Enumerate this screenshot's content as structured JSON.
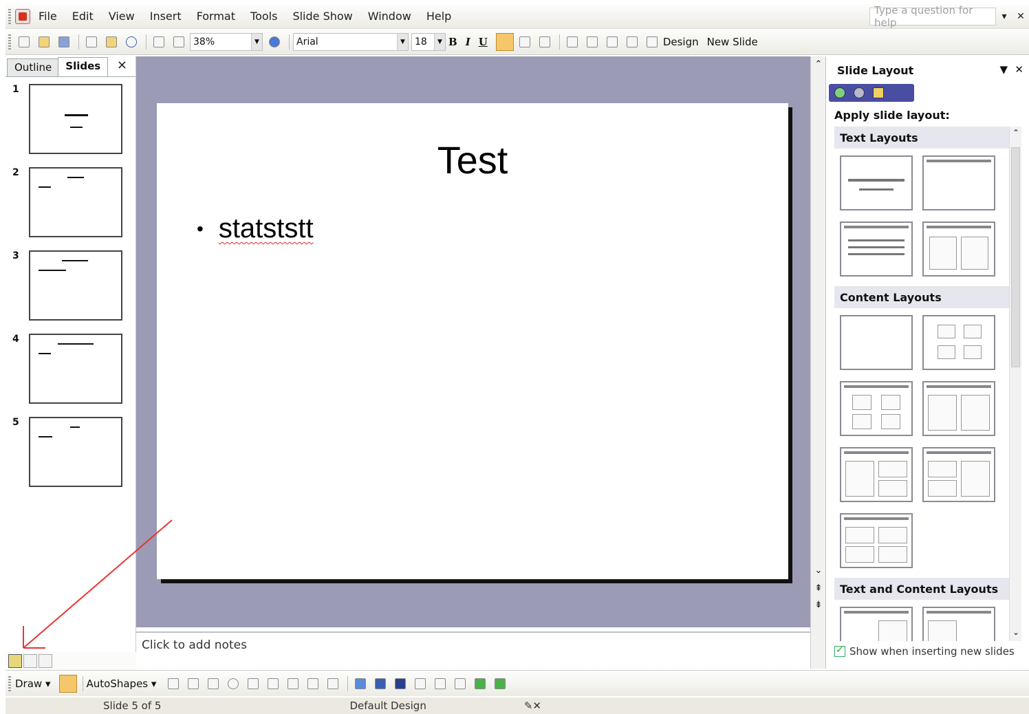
{
  "menubar": {
    "items": [
      "File",
      "Edit",
      "View",
      "Insert",
      "Format",
      "Tools",
      "Slide Show",
      "Window",
      "Help"
    ],
    "help_placeholder": "Type a question for help"
  },
  "toolbar": {
    "zoom": "38%",
    "font": "Arial",
    "size": "18",
    "bold": "B",
    "italic": "I",
    "underline": "U",
    "design_label": "Design",
    "newslide_label": "New Slide"
  },
  "left_pane": {
    "tab_outline": "Outline",
    "tab_slides": "Slides",
    "close": "×",
    "slide_numbers": [
      "1",
      "2",
      "3",
      "4",
      "5"
    ]
  },
  "slide": {
    "title": "Test",
    "bullet": "statststt"
  },
  "notes": {
    "placeholder": "Click to add notes"
  },
  "task_pane": {
    "title": "Slide Layout",
    "apply_label": "Apply slide layout:",
    "sections": [
      "Text Layouts",
      "Content Layouts",
      "Text and Content Layouts"
    ],
    "show_when": "Show when inserting new slides"
  },
  "drawbar": {
    "draw": "Draw",
    "autoshapes": "AutoShapes"
  },
  "status": {
    "slide_of": "Slide 5 of 5",
    "design": "Default Design"
  },
  "colors": {
    "stage": "#9b9bb5",
    "arrow": "#e8352f",
    "nav": "#4a4ea2"
  }
}
